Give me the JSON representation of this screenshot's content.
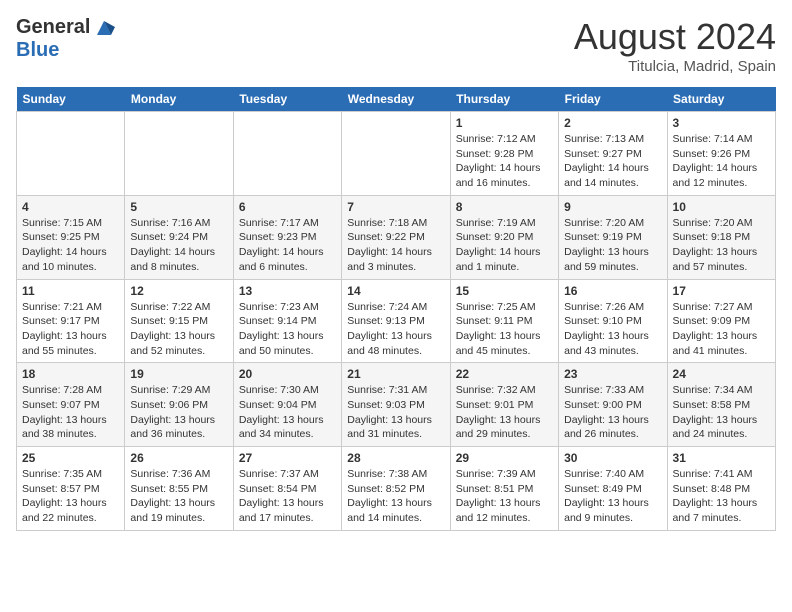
{
  "header": {
    "logo_line1": "General",
    "logo_line2": "Blue",
    "month_title": "August 2024",
    "subtitle": "Titulcia, Madrid, Spain"
  },
  "days_of_week": [
    "Sunday",
    "Monday",
    "Tuesday",
    "Wednesday",
    "Thursday",
    "Friday",
    "Saturday"
  ],
  "weeks": [
    [
      {
        "num": "",
        "info": ""
      },
      {
        "num": "",
        "info": ""
      },
      {
        "num": "",
        "info": ""
      },
      {
        "num": "",
        "info": ""
      },
      {
        "num": "1",
        "info": "Sunrise: 7:12 AM\nSunset: 9:28 PM\nDaylight: 14 hours\nand 16 minutes."
      },
      {
        "num": "2",
        "info": "Sunrise: 7:13 AM\nSunset: 9:27 PM\nDaylight: 14 hours\nand 14 minutes."
      },
      {
        "num": "3",
        "info": "Sunrise: 7:14 AM\nSunset: 9:26 PM\nDaylight: 14 hours\nand 12 minutes."
      }
    ],
    [
      {
        "num": "4",
        "info": "Sunrise: 7:15 AM\nSunset: 9:25 PM\nDaylight: 14 hours\nand 10 minutes."
      },
      {
        "num": "5",
        "info": "Sunrise: 7:16 AM\nSunset: 9:24 PM\nDaylight: 14 hours\nand 8 minutes."
      },
      {
        "num": "6",
        "info": "Sunrise: 7:17 AM\nSunset: 9:23 PM\nDaylight: 14 hours\nand 6 minutes."
      },
      {
        "num": "7",
        "info": "Sunrise: 7:18 AM\nSunset: 9:22 PM\nDaylight: 14 hours\nand 3 minutes."
      },
      {
        "num": "8",
        "info": "Sunrise: 7:19 AM\nSunset: 9:20 PM\nDaylight: 14 hours\nand 1 minute."
      },
      {
        "num": "9",
        "info": "Sunrise: 7:20 AM\nSunset: 9:19 PM\nDaylight: 13 hours\nand 59 minutes."
      },
      {
        "num": "10",
        "info": "Sunrise: 7:20 AM\nSunset: 9:18 PM\nDaylight: 13 hours\nand 57 minutes."
      }
    ],
    [
      {
        "num": "11",
        "info": "Sunrise: 7:21 AM\nSunset: 9:17 PM\nDaylight: 13 hours\nand 55 minutes."
      },
      {
        "num": "12",
        "info": "Sunrise: 7:22 AM\nSunset: 9:15 PM\nDaylight: 13 hours\nand 52 minutes."
      },
      {
        "num": "13",
        "info": "Sunrise: 7:23 AM\nSunset: 9:14 PM\nDaylight: 13 hours\nand 50 minutes."
      },
      {
        "num": "14",
        "info": "Sunrise: 7:24 AM\nSunset: 9:13 PM\nDaylight: 13 hours\nand 48 minutes."
      },
      {
        "num": "15",
        "info": "Sunrise: 7:25 AM\nSunset: 9:11 PM\nDaylight: 13 hours\nand 45 minutes."
      },
      {
        "num": "16",
        "info": "Sunrise: 7:26 AM\nSunset: 9:10 PM\nDaylight: 13 hours\nand 43 minutes."
      },
      {
        "num": "17",
        "info": "Sunrise: 7:27 AM\nSunset: 9:09 PM\nDaylight: 13 hours\nand 41 minutes."
      }
    ],
    [
      {
        "num": "18",
        "info": "Sunrise: 7:28 AM\nSunset: 9:07 PM\nDaylight: 13 hours\nand 38 minutes."
      },
      {
        "num": "19",
        "info": "Sunrise: 7:29 AM\nSunset: 9:06 PM\nDaylight: 13 hours\nand 36 minutes."
      },
      {
        "num": "20",
        "info": "Sunrise: 7:30 AM\nSunset: 9:04 PM\nDaylight: 13 hours\nand 34 minutes."
      },
      {
        "num": "21",
        "info": "Sunrise: 7:31 AM\nSunset: 9:03 PM\nDaylight: 13 hours\nand 31 minutes."
      },
      {
        "num": "22",
        "info": "Sunrise: 7:32 AM\nSunset: 9:01 PM\nDaylight: 13 hours\nand 29 minutes."
      },
      {
        "num": "23",
        "info": "Sunrise: 7:33 AM\nSunset: 9:00 PM\nDaylight: 13 hours\nand 26 minutes."
      },
      {
        "num": "24",
        "info": "Sunrise: 7:34 AM\nSunset: 8:58 PM\nDaylight: 13 hours\nand 24 minutes."
      }
    ],
    [
      {
        "num": "25",
        "info": "Sunrise: 7:35 AM\nSunset: 8:57 PM\nDaylight: 13 hours\nand 22 minutes."
      },
      {
        "num": "26",
        "info": "Sunrise: 7:36 AM\nSunset: 8:55 PM\nDaylight: 13 hours\nand 19 minutes."
      },
      {
        "num": "27",
        "info": "Sunrise: 7:37 AM\nSunset: 8:54 PM\nDaylight: 13 hours\nand 17 minutes."
      },
      {
        "num": "28",
        "info": "Sunrise: 7:38 AM\nSunset: 8:52 PM\nDaylight: 13 hours\nand 14 minutes."
      },
      {
        "num": "29",
        "info": "Sunrise: 7:39 AM\nSunset: 8:51 PM\nDaylight: 13 hours\nand 12 minutes."
      },
      {
        "num": "30",
        "info": "Sunrise: 7:40 AM\nSunset: 8:49 PM\nDaylight: 13 hours\nand 9 minutes."
      },
      {
        "num": "31",
        "info": "Sunrise: 7:41 AM\nSunset: 8:48 PM\nDaylight: 13 hours\nand 7 minutes."
      }
    ]
  ]
}
